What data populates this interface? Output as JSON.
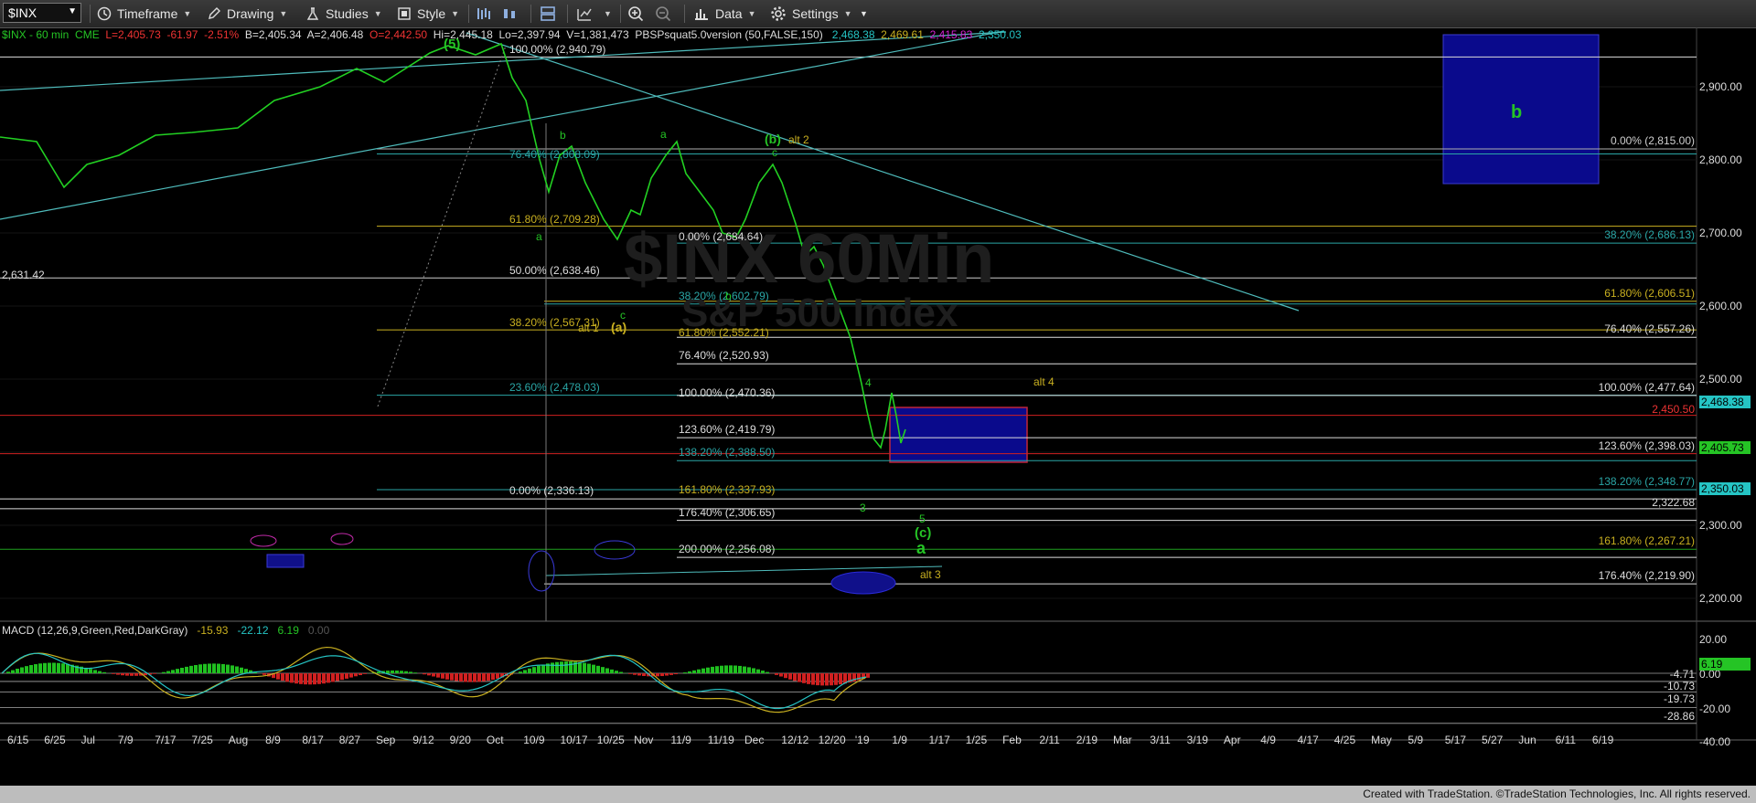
{
  "toolbar": {
    "symbol": "$INX",
    "timeframe": "Timeframe",
    "drawing": "Drawing",
    "studies": "Studies",
    "style": "Style",
    "data": "Data",
    "settings": "Settings"
  },
  "header": {
    "name": "$INX - 60 min",
    "exchange": "CME",
    "last": "L=2,405.73",
    "change": "-61.97",
    "pct": "-2.51%",
    "bid": "B=2,405.34",
    "ask": "A=2,406.48",
    "open": "O=2,442.50",
    "high": "Hi=2,445.18",
    "low": "Lo=2,397.94",
    "volume": "V=1,381,473",
    "study": "PBSPsquat5.0version (50,FALSE,150)",
    "v1": "2,468.38",
    "v2": "2,469.61",
    "v3": "2,415.83",
    "v4": "2,350.03"
  },
  "watermark": {
    "title": "$INX 60Min",
    "subtitle": "S&P 500 Index"
  },
  "price_axis": [
    "2,900.00",
    "2,800.00",
    "2,700.00",
    "2,600.00",
    "2,500.00",
    "2,300.00",
    "2,200.00"
  ],
  "price_tags": {
    "t1": "2,468.38",
    "t1_color": "#25c4c4",
    "t2": "2,405.73",
    "t2_color": "#25c425",
    "t3": "2,350.03",
    "t3_color": "#25c4c4",
    "red_level": "2,450.50",
    "gray_level": "2,322.68"
  },
  "fib_right": [
    {
      "text": "0.00% (2,815.00)",
      "color": "#cfcfcf"
    },
    {
      "text": "38.20% (2,686.13)",
      "color": "#2aa6a6"
    },
    {
      "text": "61.80% (2,606.51)",
      "color": "#c9b020"
    },
    {
      "text": "76.40% (2,557.26)",
      "color": "#dddddd"
    },
    {
      "text": "100.00% (2,477.64)",
      "color": "#dddddd"
    },
    {
      "text": "123.60% (2,398.03)",
      "color": "#dddddd"
    },
    {
      "text": "138.20% (2,348.77)",
      "color": "#2aa6a6"
    },
    {
      "text": "161.80% (2,267.21)",
      "color": "#c9b020"
    },
    {
      "text": "176.40% (2,219.90)",
      "color": "#dddddd"
    }
  ],
  "fib_mid": [
    {
      "text": "0.00% (2,684.64)",
      "color": "#dddddd"
    },
    {
      "text": "38.20% (2,602.79)",
      "color": "#2aa6a6"
    },
    {
      "text": "61.80% (2,552.21)",
      "color": "#c9b020"
    },
    {
      "text": "76.40% (2,520.93)",
      "color": "#dddddd"
    },
    {
      "text": "100.00% (2,470.36)",
      "color": "#dddddd"
    },
    {
      "text": "123.60% (2,419.79)",
      "color": "#dddddd"
    },
    {
      "text": "138.20% (2,388.50)",
      "color": "#2aa6a6"
    },
    {
      "text": "161.80% (2,337.93)",
      "color": "#c9b020"
    },
    {
      "text": "176.40% (2,306.65)",
      "color": "#dddddd"
    },
    {
      "text": "200.00% (2,256.08)",
      "color": "#dddddd"
    }
  ],
  "fib_left": [
    {
      "text": "100.00% (2,940.79)",
      "color": "#dddddd"
    },
    {
      "text": "76.40% (2,808.09)",
      "color": "#2aa6a6"
    },
    {
      "text": "61.80% (2,709.28)",
      "color": "#c9b020"
    },
    {
      "text": "50.00% (2,638.46)",
      "color": "#dddddd"
    },
    {
      "text": "38.20% (2,567.31)",
      "color": "#c9b020"
    },
    {
      "text": "23.60% (2,478.03)",
      "color": "#2aa6a6"
    },
    {
      "text": "0.00% (2,336.13)",
      "color": "#dddddd"
    }
  ],
  "left_price": "2,631.42",
  "waves": {
    "w5": "(5)",
    "wb": "b",
    "wa": "a",
    "wc": "c",
    "wa2": "a",
    "wA": "(a)",
    "wc2": "c",
    "wb2": "b",
    "wB": "(b)",
    "alt2": "alt 2",
    "alt1": "alt 1",
    "w4": "4",
    "alt4": "alt 4",
    "w3": "3",
    "w5b": "5",
    "wC": "(c)",
    "wAg": "a",
    "alt3": "alt 3",
    "boxB": "b"
  },
  "macd": {
    "label": "MACD (12,26,9,Green,Red,DarkGray)",
    "v1": "-15.93",
    "v2": "-22.12",
    "v3": "6.19",
    "v4": "0.00",
    "axis": [
      "20.00",
      "0.00",
      "-20.00",
      "-40.00"
    ],
    "levels": [
      "-4.71",
      "-10.73",
      "-19.73",
      "-28.86"
    ],
    "tag": "6.19"
  },
  "time_axis": [
    "6/15",
    "6/25",
    "Jul",
    "7/9",
    "7/17",
    "7/25",
    "Aug",
    "8/9",
    "8/17",
    "8/27",
    "Sep",
    "9/12",
    "9/20",
    "Oct",
    "10/9",
    "10/17",
    "10/25",
    "Nov",
    "11/9",
    "11/19",
    "Dec",
    "12/12",
    "12/20",
    "'19",
    "1/9",
    "1/17",
    "1/25",
    "Feb",
    "2/11",
    "2/19",
    "Mar",
    "3/11",
    "3/19",
    "Apr",
    "4/9",
    "4/17",
    "4/25",
    "May",
    "5/9",
    "5/17",
    "5/27",
    "Jun",
    "6/11",
    "6/19"
  ],
  "footer": "Created with TradeStation. ©TradeStation Technologies, Inc. All rights reserved."
}
